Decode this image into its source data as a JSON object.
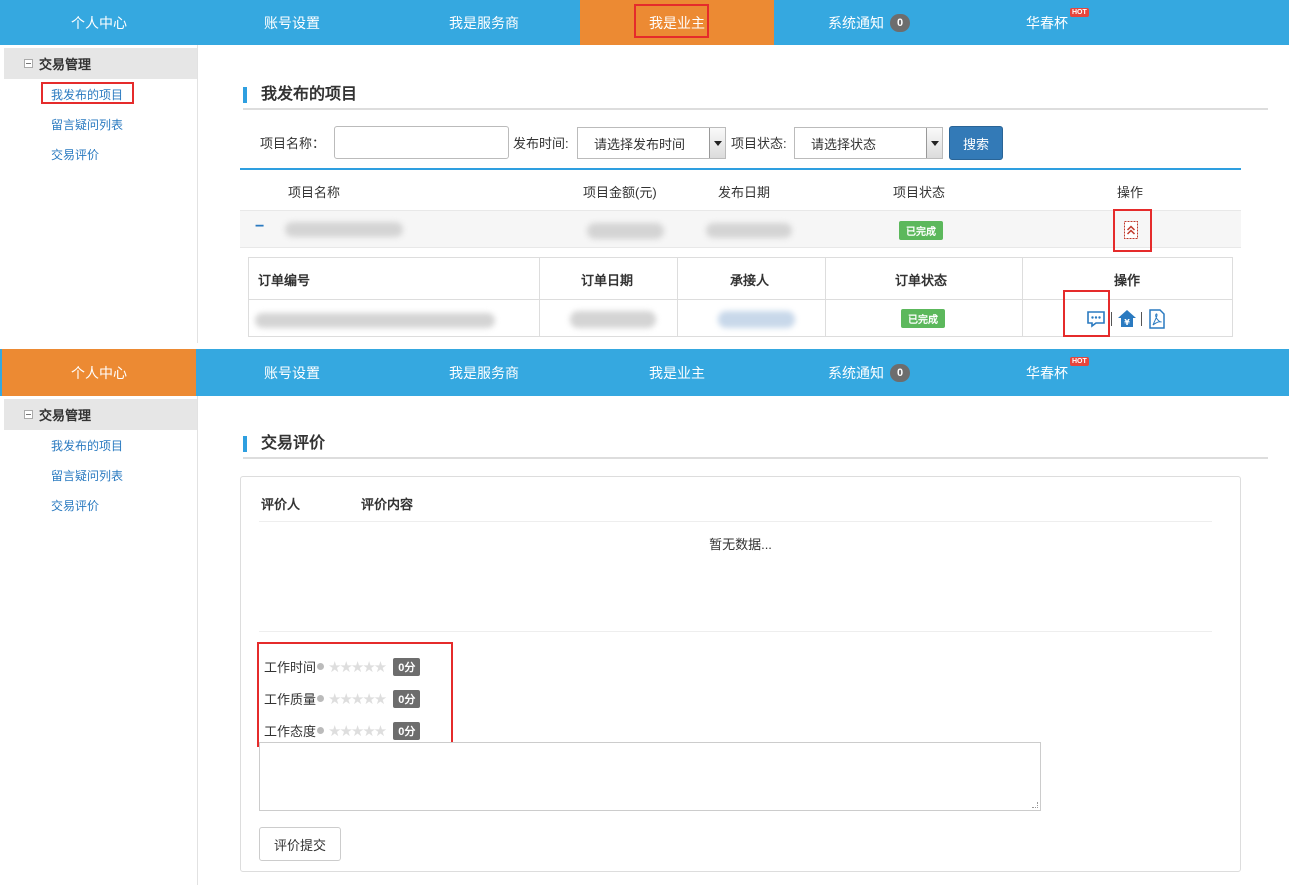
{
  "nav": {
    "items": [
      "个人中心",
      "账号设置",
      "我是服务商",
      "我是业主",
      "系统通知",
      "华春杯"
    ],
    "notify_count": "0",
    "hot_label": "HOT"
  },
  "sidebar": {
    "header": "交易管理",
    "links": [
      "我发布的项目",
      "留言疑问列表",
      "交易评价"
    ]
  },
  "projects": {
    "title": "我发布的项目",
    "filter": {
      "name_label": "项目名称：",
      "time_label": "发布时间:",
      "time_value": "请选择发布时间",
      "status_label": "项目状态:",
      "status_value": "请选择状态",
      "search_label": "搜索"
    },
    "columns": [
      "项目名称",
      "项目金额(元)",
      "发布日期",
      "项目状态",
      "操作"
    ],
    "row": {
      "toggle": "−",
      "status": "已完成"
    },
    "orders": {
      "columns": [
        "订单编号",
        "订单日期",
        "承接人",
        "订单状态",
        "操作"
      ],
      "row": {
        "status": "已完成"
      }
    }
  },
  "evaluation": {
    "title": "交易评价",
    "columns": [
      "评价人",
      "评价内容"
    ],
    "empty": "暂无数据...",
    "ratings": [
      {
        "label": "工作时间",
        "score": "0分"
      },
      {
        "label": "工作质量",
        "score": "0分"
      },
      {
        "label": "工作态度",
        "score": "0分"
      }
    ],
    "submit_label": "评价提交"
  },
  "colors": {
    "nav_bg": "#35a8e0",
    "nav_active": "#ec8a33",
    "highlight": "#e52b2b",
    "success": "#5cb85c",
    "primary": "#337ab7"
  },
  "icons": [
    "collapse-up-icon",
    "comment-icon",
    "payment-icon",
    "pdf-icon",
    "minus-icon",
    "star-icon"
  ]
}
